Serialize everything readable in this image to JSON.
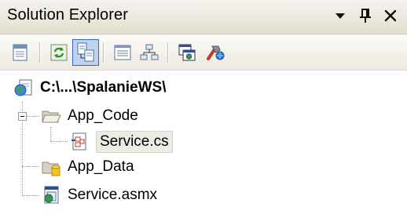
{
  "window": {
    "title": "Solution Explorer",
    "buttons": {
      "dropdown": "▾",
      "pin": "ꟷ",
      "close": "✕"
    }
  },
  "toolbar": {
    "items": [
      {
        "icon": "properties-icon"
      },
      {
        "icon": "refresh-icon"
      },
      {
        "icon": "nest-related-files-icon",
        "active": true
      },
      {
        "icon": "view-code-icon"
      },
      {
        "icon": "view-designer-icon"
      },
      {
        "icon": "copy-website-icon"
      },
      {
        "icon": "asp-net-configuration-icon"
      }
    ]
  },
  "tree": {
    "root": {
      "label": "C:\\...\\SpalanieWS\\",
      "icon": "web-project-icon"
    },
    "items": [
      {
        "label": "App_Code",
        "icon": "folder-open-icon",
        "expanded": true,
        "level": 1
      },
      {
        "label": "Service.cs",
        "icon": "csharp-file-icon",
        "level": 2,
        "selected": true
      },
      {
        "label": "App_Data",
        "icon": "data-folder-icon",
        "level": 1
      },
      {
        "label": "Service.asmx",
        "icon": "asmx-file-icon",
        "level": 1
      }
    ]
  }
}
